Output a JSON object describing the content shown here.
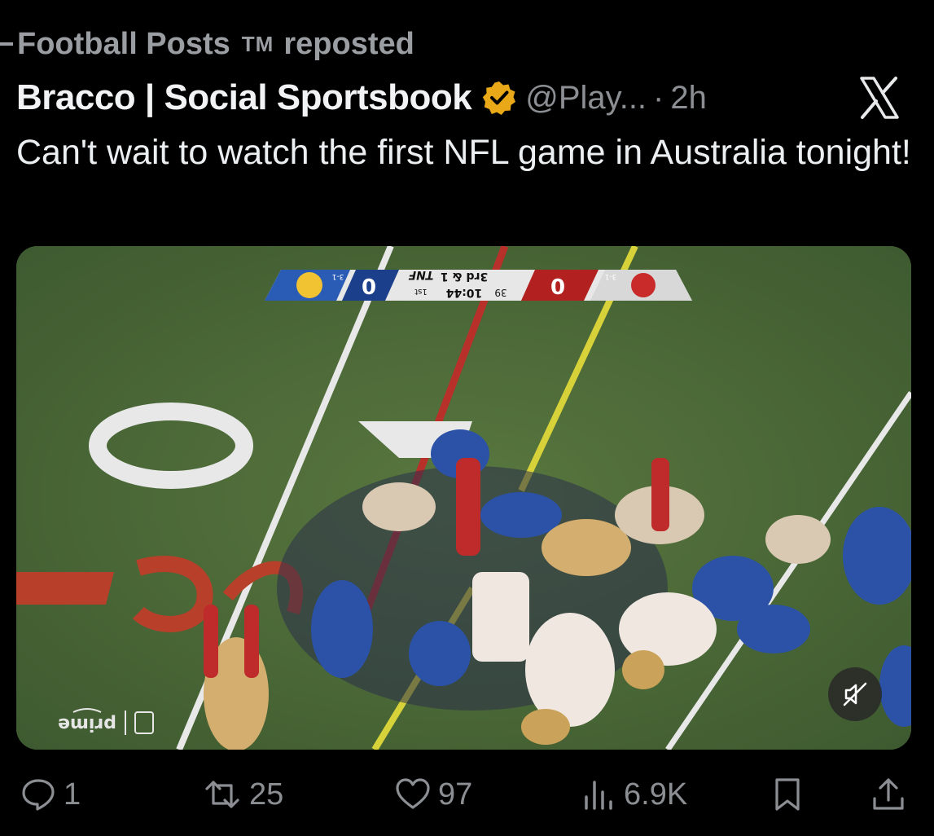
{
  "repost": {
    "account": "Football Posts",
    "tm": "TM",
    "label": "reposted"
  },
  "tweet": {
    "author": "Bracco | Social Sportsbook",
    "handle": "@Play...",
    "separator": "·",
    "time": "2h",
    "text": "Can't wait to watch the first NFL game in Australia tonight!"
  },
  "scorebug": {
    "away_score": "0",
    "home_score": "0",
    "away_record": "3-1",
    "home_record": "3-1",
    "clock": "10:44",
    "quarter": "1st",
    "play_clock": "39",
    "down": "3rd & 1",
    "network": "TNF"
  },
  "broadcast": {
    "logo": "prime"
  },
  "actions": {
    "replies": "1",
    "reposts": "25",
    "likes": "97",
    "views": "6.9K"
  },
  "colors": {
    "background": "#000000",
    "text": "#e7e9ea",
    "muted": "#8b8e92",
    "verified_gold": "#e8a817",
    "field_green": "#4d6a3a"
  },
  "icons": {
    "verified": "verified-badge-icon",
    "close": "x-logo-icon",
    "reply": "reply-icon",
    "repost": "repost-icon",
    "like": "heart-icon",
    "views": "views-icon",
    "bookmark": "bookmark-icon",
    "share": "share-icon",
    "mute": "muted-speaker-icon"
  }
}
